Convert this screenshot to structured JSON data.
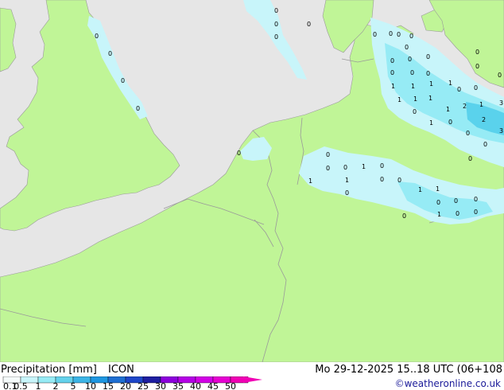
{
  "map": {
    "colors": {
      "sea": "#e6e6e6",
      "land": "#c0f597",
      "border": "#9a9a9a",
      "precip_light": "#c8f5fa",
      "precip_medium": "#96ebf5",
      "precip_strong": "#5ad2ec"
    },
    "point_values": [
      "0",
      "0",
      "0",
      "0",
      "0",
      "0",
      "0",
      "0",
      "0",
      "0",
      "0",
      "0",
      "0",
      "0",
      "0",
      "0",
      "0",
      "0",
      "0",
      "0",
      "0",
      "0",
      "0",
      "0",
      "0",
      "1",
      "1",
      "1",
      "1",
      "1",
      "1",
      "1",
      "1",
      "1",
      "2",
      "2",
      "3",
      "3",
      "1",
      "0",
      "0",
      "0",
      "0",
      "0",
      "0",
      "0",
      "0",
      "1",
      "0",
      "1",
      "1",
      "0",
      "0",
      "1",
      "1",
      "0",
      "0",
      "0",
      "0",
      "1",
      "0",
      "0",
      "0"
    ]
  },
  "footer": {
    "title": "Precipitation [mm]",
    "model": "ICON",
    "datetime": "Mo 29-12-2025 15..18 UTC (06+108",
    "credit": "©weatheronline.co.uk"
  },
  "legend": {
    "ticks": [
      "0.1",
      "0.5",
      "1",
      "2",
      "5",
      "10",
      "15",
      "20",
      "25",
      "30",
      "35",
      "40",
      "45",
      "50"
    ],
    "colors": [
      "#f5fafa",
      "#c8f5fa",
      "#96ebf5",
      "#64d2ec",
      "#3cb4e6",
      "#1e96e1",
      "#1e6ed2",
      "#1e46c8",
      "#1e1ea0",
      "#8c00dc",
      "#b400e6",
      "#d200e6",
      "#e600d2",
      "#f000b4"
    ]
  }
}
